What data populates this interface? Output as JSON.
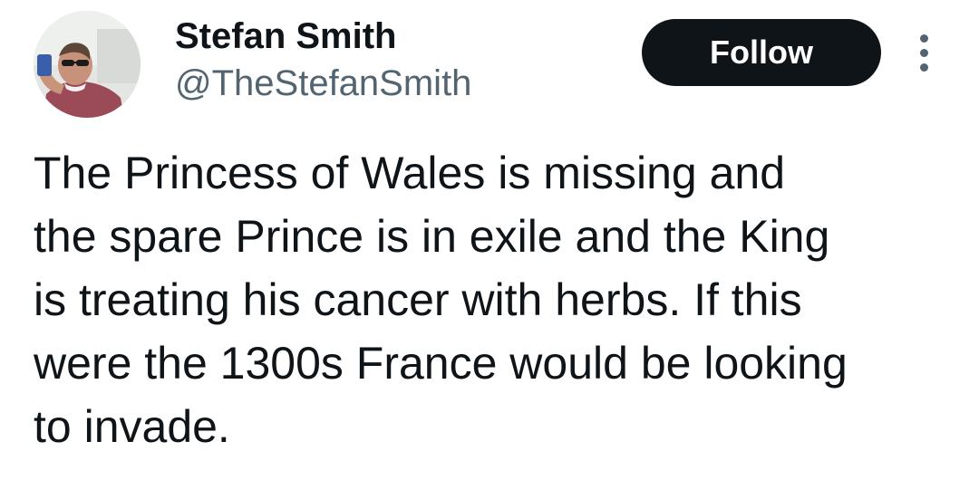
{
  "author": {
    "display_name": "Stefan Smith",
    "handle": "@TheStefanSmith"
  },
  "actions": {
    "follow_label": "Follow",
    "more_icon": "more-vertical-icon"
  },
  "tweet": {
    "lines": [
      "The Princess of Wales is missing and",
      "the spare Prince is in exile and the King",
      "is treating his cancer with herbs. If this",
      "were the 1300s France would be looking",
      "to invade."
    ]
  },
  "colors": {
    "text_primary": "#0f1419",
    "text_secondary": "#536471",
    "button_bg": "#0f1419",
    "button_text": "#ffffff",
    "background": "#ffffff"
  }
}
